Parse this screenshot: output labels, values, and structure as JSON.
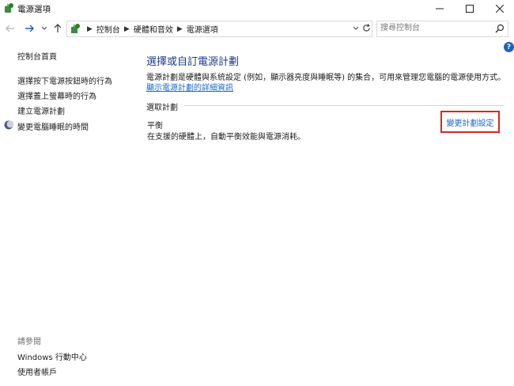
{
  "window": {
    "title": "電源選項",
    "app_icon": "power-options-icon",
    "controls": [
      "minimize",
      "maximize",
      "close"
    ]
  },
  "nav": {
    "back_icon": "back-arrow-icon",
    "forward_icon": "forward-arrow-icon",
    "recent_icon": "chevron-down-icon",
    "up_icon": "up-arrow-icon",
    "breadcrumbs": [
      "控制台",
      "硬體和音效",
      "電源選項"
    ],
    "refresh_icon": "refresh-icon",
    "search_placeholder": "搜尋控制台"
  },
  "sidebar": {
    "home": "控制台首頁",
    "links": [
      "選擇按下電源按鈕時的行為",
      "選擇蓋上螢幕時的行為",
      "建立電源計劃",
      "變更電腦睡眠的時間"
    ],
    "see_also_label": "請參閱",
    "see_also": [
      "Windows 行動中心",
      "使用者帳戶"
    ]
  },
  "main": {
    "title": "選擇或自訂電源計劃",
    "description": "電源計劃是硬體與系統設定 (例如，顯示器亮度與睡眠等) 的集合，可用來管理您電腦的電源使用方式。",
    "detail_link": "顯示電源計劃的詳細資訊",
    "section_label": "選取計劃",
    "plan": {
      "name": "平衡",
      "description": "在支援的硬體上，自動平衡效能與電源消耗。",
      "change_link": "變更計劃設定"
    }
  },
  "colors": {
    "title_blue": "#1e3c8c",
    "link_blue": "#1a6ac7",
    "highlight_red": "#d9291c",
    "help_blue": "#1a63c6"
  }
}
